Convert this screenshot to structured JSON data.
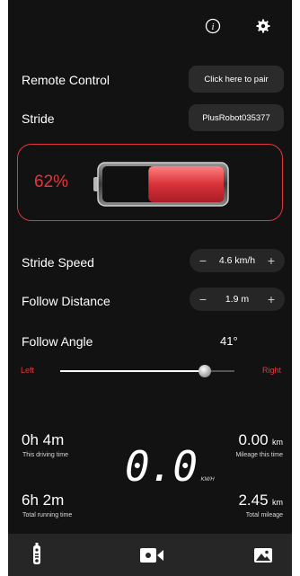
{
  "top_icons": {
    "info": "info-icon",
    "settings": "gear-icon"
  },
  "remote_control": {
    "label": "Remote Control",
    "button": "Click here to pair"
  },
  "stride": {
    "label": "Stride",
    "device": "PlusRobot035377"
  },
  "battery": {
    "percent_text": "62%",
    "level": 0.62,
    "color": "#e0383c"
  },
  "stride_speed": {
    "label": "Stride Speed",
    "minus": "−",
    "value": "4.6 km/h",
    "plus": "+"
  },
  "follow_distance": {
    "label": "Follow Distance",
    "minus": "−",
    "value": "1.9 m",
    "plus": "+"
  },
  "follow_angle": {
    "label": "Follow Angle",
    "value": "41°",
    "left": "Left",
    "right": "Right",
    "slider_position": 0.83
  },
  "stats": {
    "driving_time": {
      "value": "0h 4m",
      "label": "This driving time"
    },
    "mileage": {
      "value": "0.00",
      "unit": "km",
      "label": "Mileage this time"
    },
    "running_time": {
      "value": "6h 2m",
      "label": "Total running time"
    },
    "total_mileage": {
      "value": "2.45",
      "unit": "km",
      "label": "Total mileage"
    },
    "speed": {
      "value": "0.0",
      "unit": "KM/H"
    }
  },
  "tabbar": {
    "tabs": [
      "remote-icon",
      "video-camera-icon",
      "gallery-icon"
    ]
  },
  "colors": {
    "background": "#121212",
    "accent_red": "#e0383c",
    "panel": "#262626"
  }
}
